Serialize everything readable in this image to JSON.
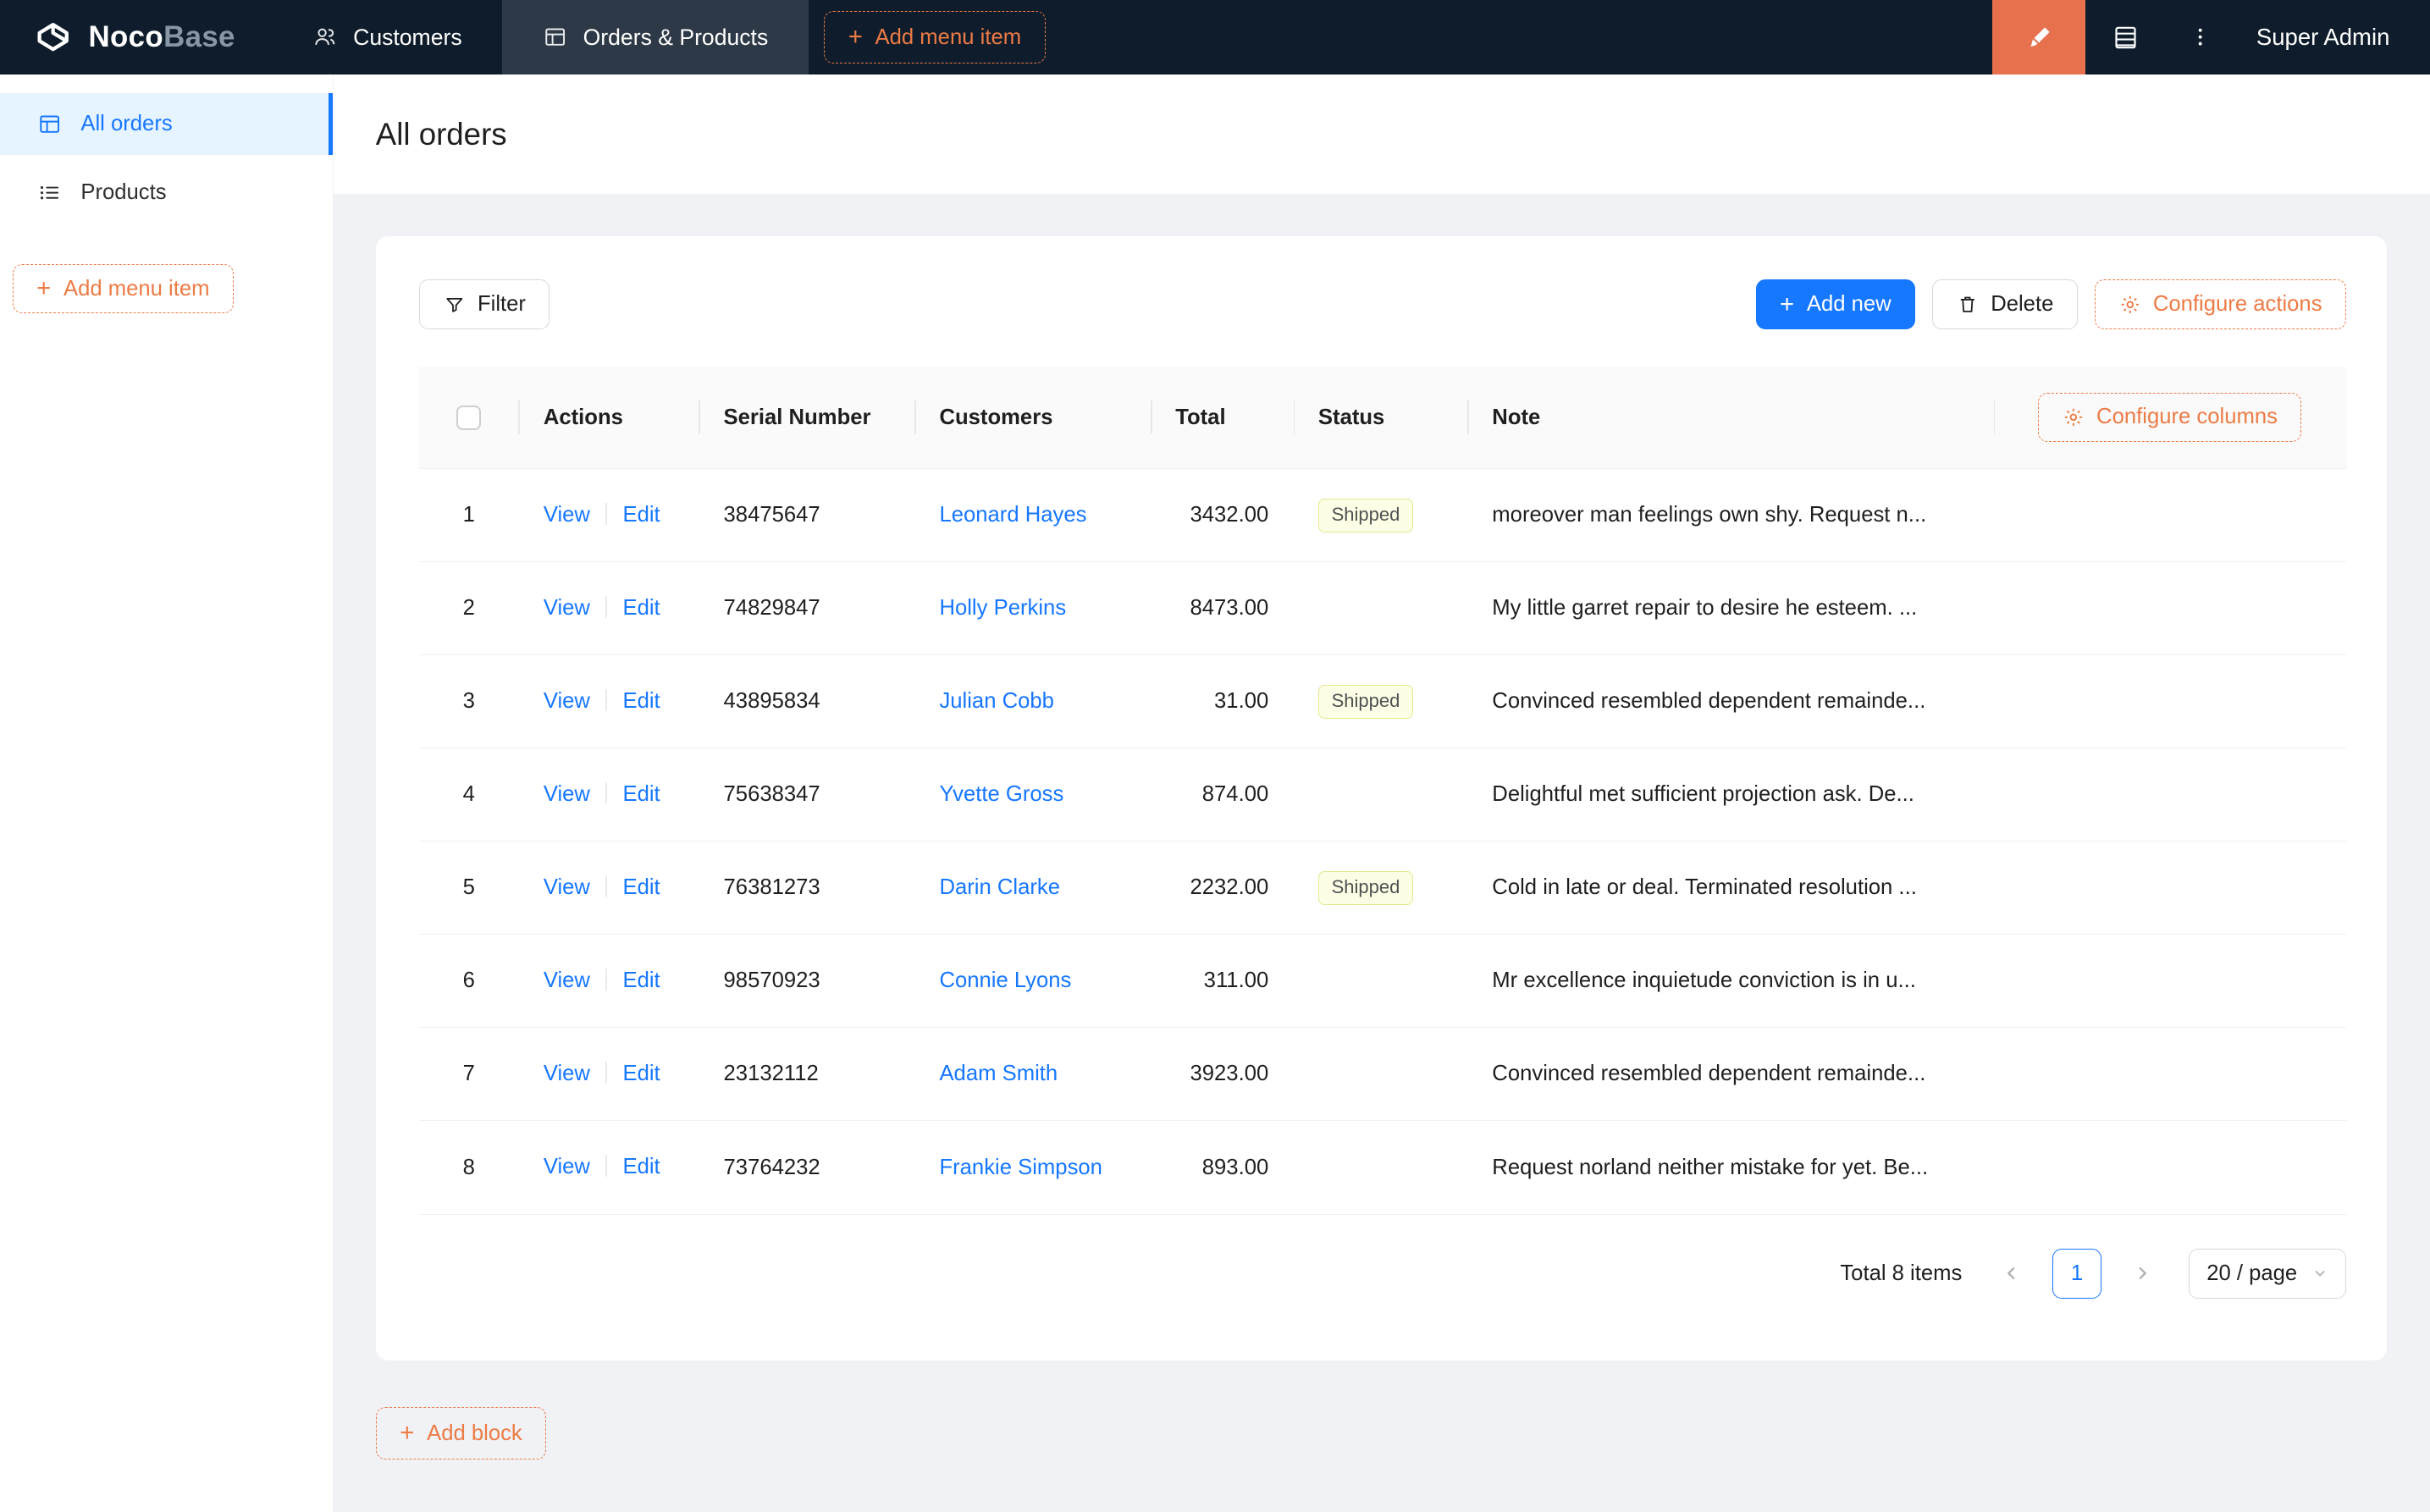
{
  "colors": {
    "accent_orange": "#ed7b45",
    "primary_blue": "#1677ff",
    "navbar_bg": "#0e1c2b",
    "shipped_tag_bg": "#fcffe6"
  },
  "header": {
    "logo_primary": "Noco",
    "logo_secondary": "Base",
    "menu": [
      {
        "label": "Customers"
      },
      {
        "label": "Orders & Products"
      }
    ],
    "add_menu_item_label": "Add menu item",
    "user": "Super Admin"
  },
  "icons": {
    "logo": "cube-logo-icon",
    "customers_menu": "people-icon",
    "orders_menu": "table-icon",
    "designer": "paintbrush-icon",
    "collections": "collections-icon",
    "more": "kebab-menu-icon",
    "all_orders": "table-icon",
    "products": "list-icon",
    "filter": "funnel-icon",
    "delete": "trash-icon",
    "configure": "gear-icon"
  },
  "sidebar": {
    "items": [
      {
        "label": "All orders",
        "active": true
      },
      {
        "label": "Products",
        "active": false
      }
    ],
    "add_menu_item_label": "Add menu item"
  },
  "page": {
    "title": "All orders"
  },
  "toolbar": {
    "filter_label": "Filter",
    "add_new_label": "Add new",
    "delete_label": "Delete",
    "configure_actions_label": "Configure actions"
  },
  "table": {
    "headers": [
      "Actions",
      "Serial Number",
      "Customers",
      "Total",
      "Status",
      "Note"
    ],
    "configure_columns_label": "Configure columns",
    "view_label": "View",
    "edit_label": "Edit",
    "rows": [
      {
        "index": "1",
        "serial": "38475647",
        "customer": "Leonard Hayes",
        "total": "3432.00",
        "status": "Shipped",
        "note": "moreover man feelings own shy. Request n..."
      },
      {
        "index": "2",
        "serial": "74829847",
        "customer": "Holly Perkins",
        "total": "8473.00",
        "status": "",
        "note": "My little garret repair to desire he esteem. ..."
      },
      {
        "index": "3",
        "serial": "43895834",
        "customer": "Julian Cobb",
        "total": "31.00",
        "status": "Shipped",
        "note": "Convinced resembled dependent remainde..."
      },
      {
        "index": "4",
        "serial": "75638347",
        "customer": "Yvette Gross",
        "total": "874.00",
        "status": "",
        "note": "Delightful met sufficient projection ask. De..."
      },
      {
        "index": "5",
        "serial": "76381273",
        "customer": "Darin Clarke",
        "total": "2232.00",
        "status": "Shipped",
        "note": "Cold in late or deal. Terminated resolution ..."
      },
      {
        "index": "6",
        "serial": "98570923",
        "customer": "Connie Lyons",
        "total": "311.00",
        "status": "",
        "note": "Mr excellence inquietude conviction is in u..."
      },
      {
        "index": "7",
        "serial": "23132112",
        "customer": "Adam Smith",
        "total": "3923.00",
        "status": "",
        "note": "Convinced resembled dependent remainde..."
      },
      {
        "index": "8",
        "serial": "73764232",
        "customer": "Frankie Simpson",
        "total": "893.00",
        "status": "",
        "note": "Request norland neither mistake for yet. Be..."
      }
    ]
  },
  "pagination": {
    "total_label": "Total 8 items",
    "current_page": "1",
    "page_size": "20 / page"
  },
  "add_block_label": "Add block"
}
